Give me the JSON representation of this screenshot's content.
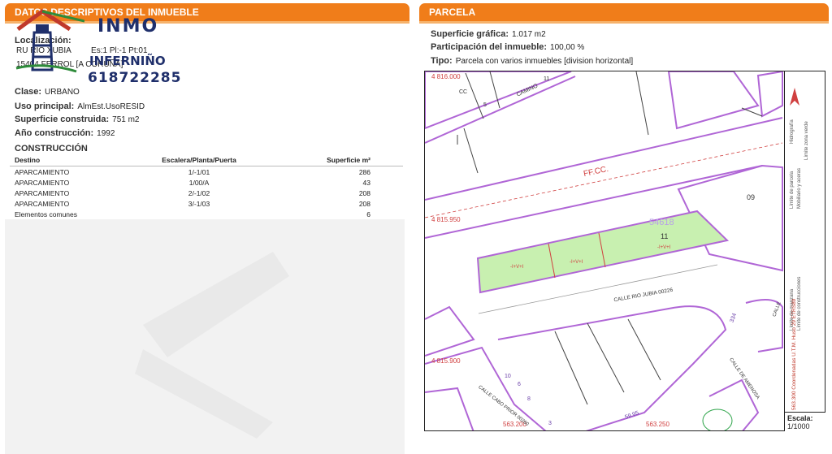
{
  "left": {
    "header": "DATOS DESCRIPTIVOS DEL INMUEBLE",
    "localizacion_label": "Localización:",
    "address_line1": "RU RIO XUBIA",
    "address_detail": "Es:1 Pl:-1 Pt:01",
    "address_line2": "15404 FERROL [A CORUÑA]",
    "clase_label": "Clase:",
    "clase_value": "URBANO",
    "uso_label": "Uso principal:",
    "uso_value": "AlmEst.UsoRESID",
    "superficie_label": "Superficie construida:",
    "superficie_value": "751 m2",
    "anio_label": "Año construcción:",
    "anio_value": "1992",
    "construccion_title": "CONSTRUCCIÓN",
    "table": {
      "headers": [
        "Destino",
        "Escalera/Planta/Puerta",
        "Superficie m²"
      ],
      "rows": [
        [
          "APARCAMIENTO",
          "1/-1/01",
          "286"
        ],
        [
          "APARCAMIENTO",
          "1/00/A",
          "43"
        ],
        [
          "APARCAMIENTO",
          "2/-1/02",
          "208"
        ],
        [
          "APARCAMIENTO",
          "3/-1/03",
          "208"
        ],
        [
          "Elementos comunes",
          "",
          "6"
        ]
      ]
    }
  },
  "logo": {
    "brand1": "INMO",
    "brand2": "INFERNIÑO",
    "phone": "618722285"
  },
  "right": {
    "header": "PARCELA",
    "sup_grafica_label": "Superficie gráfica:",
    "sup_grafica_value": "1.017 m2",
    "participacion_label": "Participación del inmueble:",
    "participacion_value": "100,00 %",
    "tipo_label": "Tipo:",
    "tipo_value": "Parcela con varios inmuebles [division horizontal]"
  },
  "map": {
    "coords": {
      "y_top": "4 816.000",
      "y_mid": "4 815.950",
      "y_bot": "4 815.900",
      "x_left": "563.200",
      "x_right": "563.250"
    },
    "labels": {
      "ffcc": "FF.CC.",
      "camino": "CAMINO",
      "parcel_ref": "54618",
      "parcel_num": "11",
      "num_09": "09",
      "calle_rio": "CALLE RIO JUBIA 00226",
      "calle_cabo": "CALLE CABO PRIOR 00260",
      "calle_amenosa": "CALLE DE AMENOSA",
      "calle_top": "CALLE",
      "n10": "10",
      "n6": "6",
      "n8": "8",
      "n5": "5",
      "n11": "11",
      "n3": "3",
      "ref_5995": "59.95",
      "ref_334": "334",
      "cc": "CC",
      "bldg_1": "-I+V+I",
      "bldg_2": "-I+V+I",
      "bldg_3": "-I+V+I"
    },
    "legend": {
      "item1": "Límite de manzana",
      "item2": "Límite de parcela",
      "item3": "Límite de construcciones",
      "item4": "Mobiliario y aceras",
      "item5": "Límite zona verde",
      "item6": "Hidrografía",
      "coords_note": "563.300  Coordenadas U.T.M. Huso 29 ETRS89"
    },
    "escala_label": "Escala:",
    "escala_value": "1/1000",
    "colors": {
      "manzana": "#b066d6",
      "parcel_fill": "#c8f0b0",
      "parcel_stroke": "#b066d6",
      "rail": "#d04040"
    }
  }
}
